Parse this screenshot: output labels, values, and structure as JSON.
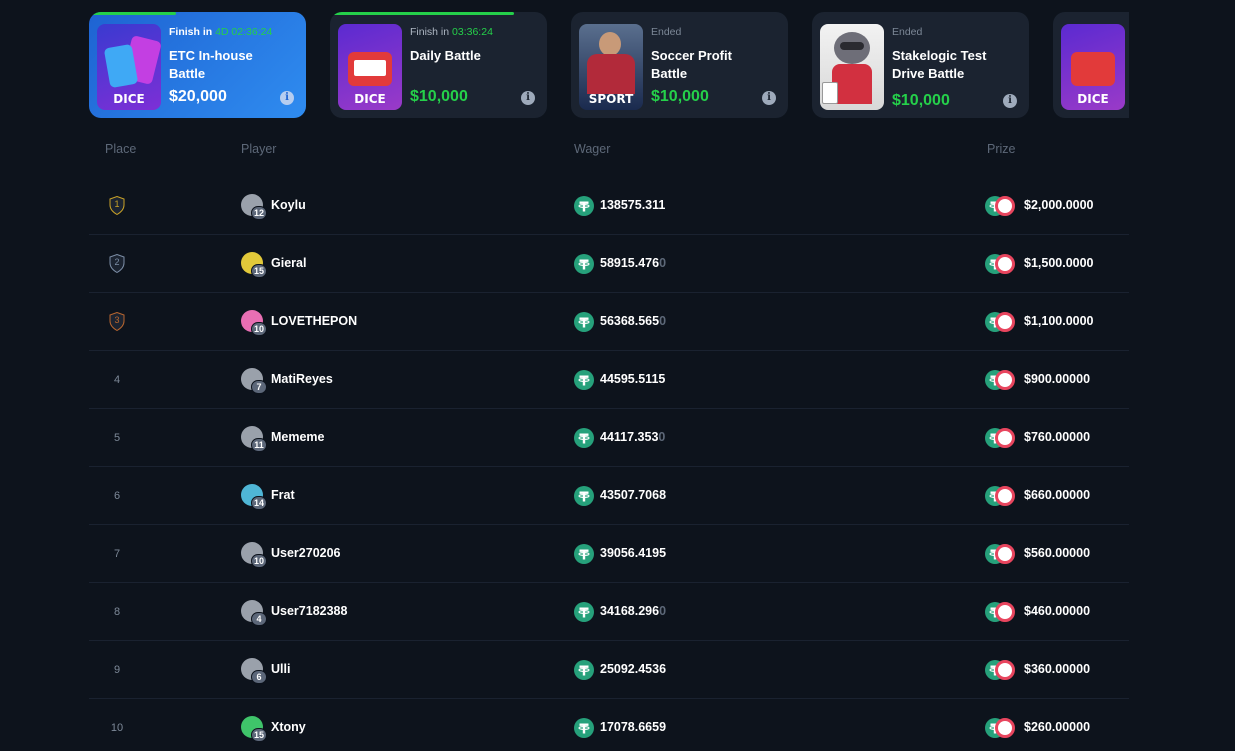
{
  "battles": [
    {
      "status_prefix": "Finish in",
      "time": "4D 02:36:24",
      "title": "ETC In-house Battle",
      "amount": "$20,000",
      "thumb_text": "DICE",
      "progress": 0.4
    },
    {
      "status_prefix": "Finish in",
      "time": "03:36:24",
      "title": "Daily Battle",
      "amount": "$10,000",
      "thumb_text": "DICE",
      "progress": 0.85
    },
    {
      "status_prefix": "Ended",
      "time": "",
      "title": "Soccer Profit Battle",
      "amount": "$10,000",
      "thumb_text": "SPORT"
    },
    {
      "status_prefix": "Ended",
      "time": "",
      "title": "Stakelogic Test Drive Battle",
      "amount": "$10,000",
      "thumb_text": ""
    },
    {
      "status_prefix": "",
      "time": "",
      "title": "",
      "amount": "",
      "thumb_text": "DICE"
    }
  ],
  "info_icon_glyph": "i",
  "table": {
    "headers": {
      "place": "Place",
      "player": "Player",
      "wager": "Wager",
      "prize": "Prize"
    },
    "rows": [
      {
        "place": "1",
        "player": "Koylu",
        "level": "12",
        "wager": "138575.311",
        "wager_dim": "",
        "prize": "$2,000.0000",
        "avatar_color": "#9aa1ab"
      },
      {
        "place": "2",
        "player": "Gieral",
        "level": "15",
        "wager": "58915.476",
        "wager_dim": "0",
        "prize": "$1,500.0000",
        "avatar_color": "#e2c93a"
      },
      {
        "place": "3",
        "player": "LOVETHEPON",
        "level": "10",
        "wager": "56368.565",
        "wager_dim": "0",
        "prize": "$1,100.0000",
        "avatar_color": "#e86fb3"
      },
      {
        "place": "4",
        "player": "MatiReyes",
        "level": "7",
        "wager": "44595.5115",
        "wager_dim": "",
        "prize": "$900.00000",
        "avatar_color": "#9aa1ab"
      },
      {
        "place": "5",
        "player": "Mememe",
        "level": "11",
        "wager": "44117.353",
        "wager_dim": "0",
        "prize": "$760.00000",
        "avatar_color": "#9aa1ab"
      },
      {
        "place": "6",
        "player": "Frat",
        "level": "14",
        "wager": "43507.7068",
        "wager_dim": "",
        "prize": "$660.00000",
        "avatar_color": "#4fb6d6"
      },
      {
        "place": "7",
        "player": "User270206",
        "level": "10",
        "wager": "39056.4195",
        "wager_dim": "",
        "prize": "$560.00000",
        "avatar_color": "#9aa1ab"
      },
      {
        "place": "8",
        "player": "User7182388",
        "level": "4",
        "wager": "34168.296",
        "wager_dim": "0",
        "prize": "$460.00000",
        "avatar_color": "#9aa1ab"
      },
      {
        "place": "9",
        "player": "Ulli",
        "level": "6",
        "wager": "25092.4536",
        "wager_dim": "",
        "prize": "$360.00000",
        "avatar_color": "#9aa1ab"
      },
      {
        "place": "10",
        "player": "Xtony",
        "level": "15",
        "wager": "17078.6659",
        "wager_dim": "",
        "prize": "$260.00000",
        "avatar_color": "#3fc46a"
      }
    ]
  },
  "colors": {
    "accent_green": "#25d04a",
    "tether": "#26a17b",
    "gold": "#c9a227",
    "silver": "#7c8ea6",
    "bronze": "#b8662f"
  }
}
